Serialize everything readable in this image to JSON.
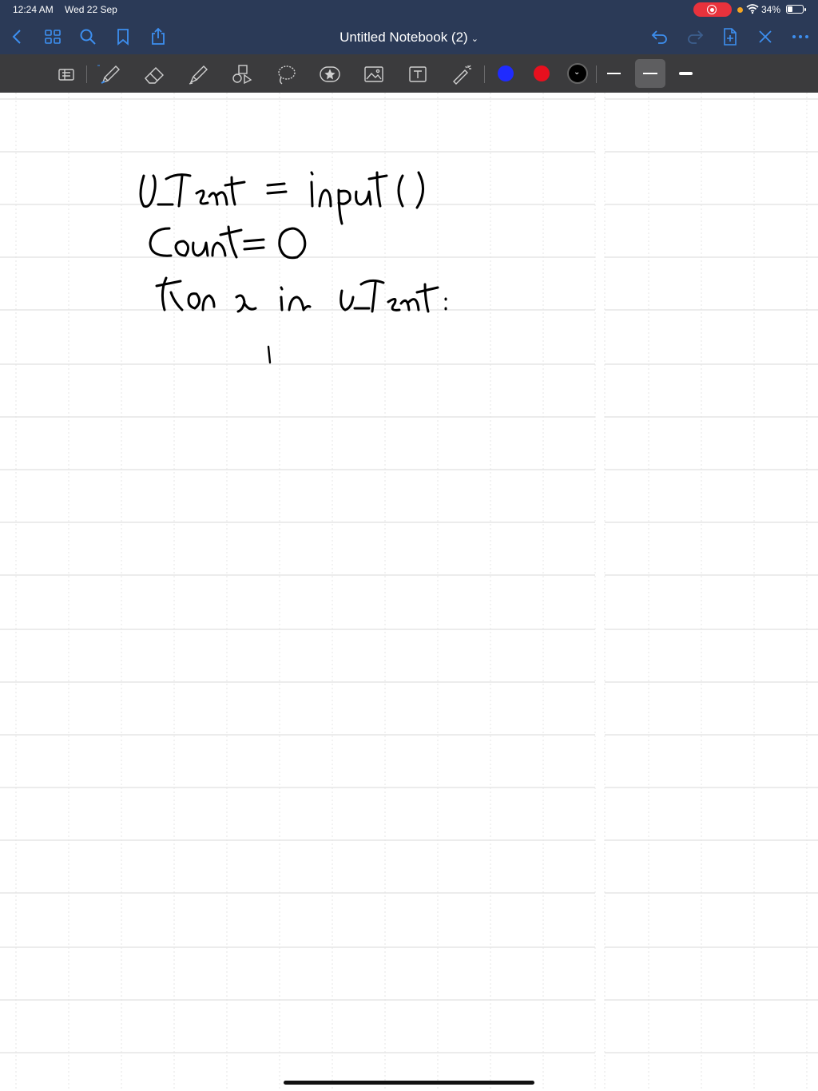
{
  "status_bar": {
    "time": "12:24 AM",
    "date": "Wed 22 Sep",
    "battery": "34%",
    "battery_level": 0.34
  },
  "nav": {
    "title": "Untitled Notebook (2)",
    "title_chevron": "⌄",
    "accent_color": "#3d8ff0",
    "left_icons": [
      "back-icon",
      "grid-icon",
      "search-icon",
      "bookmark-icon",
      "share-icon"
    ],
    "right_icons": [
      "undo-icon",
      "redo-icon",
      "add-page-icon",
      "close-icon",
      "more-icon"
    ]
  },
  "toolbar": {
    "tools": [
      "keyboard-icon",
      "pen-icon",
      "eraser-icon",
      "highlighter-icon",
      "shapes-icon",
      "lasso-icon",
      "sticker-icon",
      "image-icon",
      "text-icon",
      "laser-pointer-icon"
    ],
    "colors": [
      "#1f2bff",
      "#e8101e",
      "#000000"
    ],
    "selected_color": "#000000",
    "stroke_widths": [
      "thin",
      "medium",
      "thick"
    ],
    "selected_stroke": "medium"
  }
}
